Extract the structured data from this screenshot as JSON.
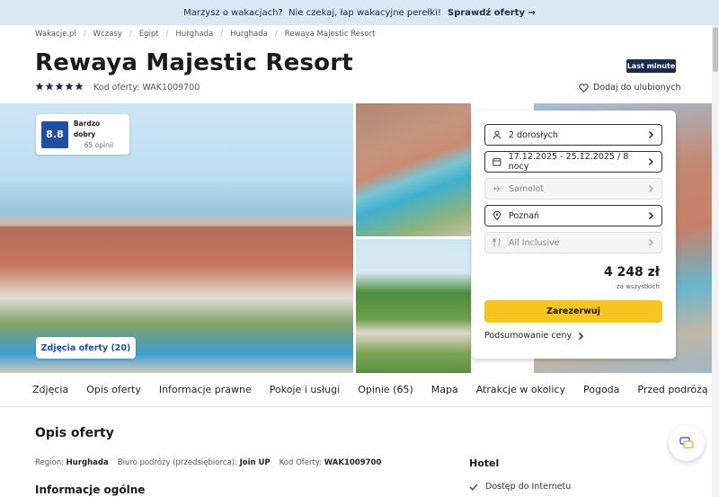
{
  "topbar": {
    "message": "Marzysz o wakacjach?  Nie czekaj, łap wakacyjne perełki! ",
    "cta_label": "Sprawdź oferty →"
  },
  "breadcrumb": [
    "Wakacje.pl",
    "Wczasy",
    "Egipt",
    "Hurghada",
    "Hurghada",
    "Rewaya Majestic Resort"
  ],
  "hotel": {
    "name": "Rewaya Majestic Resort",
    "badge": "Last minute",
    "stars": 5,
    "offer_code_label": "Kod oferty: WAK1009700",
    "favorite_label": "Dodaj do ulubionych"
  },
  "rating": {
    "score": "8.8",
    "label": "Bardzo dobry",
    "count": "65 opinii"
  },
  "gallery": {
    "photos_button": "Zdjęcia oferty (20)"
  },
  "booking": {
    "fields": [
      {
        "icon": "person-icon",
        "value": "2 dorosłych",
        "disabled": false
      },
      {
        "icon": "calendar-icon",
        "value": "17.12.2025 - 25.12.2025 / 8 nocy",
        "disabled": false
      },
      {
        "icon": "plane-icon",
        "value": "Samolot",
        "disabled": true
      },
      {
        "icon": "location-pin-icon",
        "value": "Poznań",
        "disabled": false
      },
      {
        "icon": "cutlery-icon",
        "value": "All Inclusive",
        "disabled": true
      }
    ],
    "price": "4 248 zł",
    "price_note": "za wszystkich",
    "reserve_label": "Zarezerwuj",
    "summary_label": "Podsumowanie ceny"
  },
  "tabs": [
    "Zdjęcia",
    "Opis oferty",
    "Informacje prawne",
    "Pokoje i usługi",
    "Opinie (65)",
    "Mapa",
    "Atrakcje w okolicy",
    "Pogoda",
    "Przed podróżą"
  ],
  "description": {
    "title": "Opis oferty",
    "region_label": "Region:",
    "region_value": "Hurghada",
    "operator_label": "Biuro podróży (przedsiębiorca):",
    "operator_value": "Join UP",
    "code_label": "Kod Oferty:",
    "code_value": "WAK1009700",
    "general_title": "Informacje ogólne"
  },
  "hotel_features": {
    "title": "Hotel",
    "items": [
      "Dostęp do Internetu"
    ]
  },
  "colors": {
    "accent_blue": "#1e4fa3",
    "cta_yellow": "#f6c521",
    "topbar_bg": "#dbe6f6",
    "badge_navy": "#1b2a4e"
  }
}
